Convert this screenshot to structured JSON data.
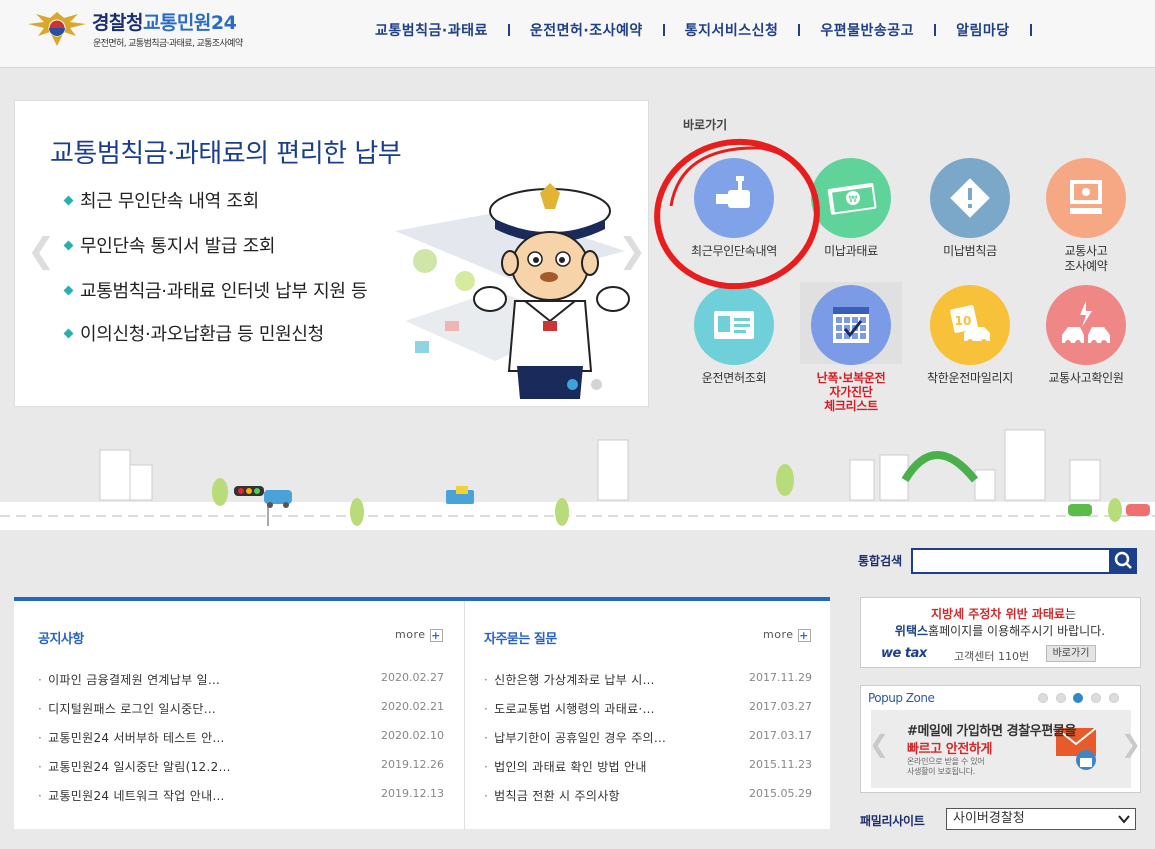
{
  "header": {
    "logo_title_1": "경찰청",
    "logo_title_2": "교통민원24",
    "logo_sub": "운전면허, 교통범칙금·과태료, 교통조사예약",
    "nav": [
      "교통범칙금·과태료",
      "운전면허·조사예약",
      "통지서비스신청",
      "우편물반송공고",
      "알림마당"
    ]
  },
  "banner": {
    "title": "교통범칙금·과태료의 편리한 납부",
    "bullets": [
      "최근 무인단속 내역 조회",
      "무인단속 통지서 발급 조회",
      "교통범칙금·과태료 인터넷 납부 지원 등",
      "이의신청·과오납환급 등 민원신청"
    ],
    "prev_arrow": "❮",
    "next_arrow": "❯",
    "active_slide": 1,
    "slide_count": 2
  },
  "quick": {
    "label": "바로가기",
    "items": [
      {
        "label": "최근무인단속내역",
        "color": "#7fa2e8",
        "icon": "camera-icon"
      },
      {
        "label": "미납과태료",
        "color": "#5fd39a",
        "icon": "money-icon"
      },
      {
        "label": "미납범칙금",
        "color": "#7ba7c9",
        "icon": "warning-icon"
      },
      {
        "label": "교통사고\n조사예약",
        "color": "#f5a883",
        "icon": "computer-icon"
      },
      {
        "label": "운전면허조회",
        "color": "#6fd0d9",
        "icon": "license-card-icon"
      },
      {
        "label": "난폭·보복운전\n자가진단\n체크리스트",
        "color": "#7b9be6",
        "icon": "calendar-check-icon"
      },
      {
        "label": "착한운전마일리지",
        "color": "#f7c23a",
        "icon": "mileage-car-icon"
      },
      {
        "label": "교통사고확인원",
        "color": "#ef8787",
        "icon": "car-crash-icon"
      }
    ]
  },
  "search": {
    "label": "통합검색",
    "placeholder": ""
  },
  "notice": {
    "title": "공지사항",
    "more": "more",
    "rows": [
      {
        "title": "이파인 금융결제원 연계납부 일…",
        "date": "2020.02.27"
      },
      {
        "title": "디지털원패스 로그인 일시중단…",
        "date": "2020.02.21"
      },
      {
        "title": "교통민원24 서버부하 테스트 안…",
        "date": "2020.02.10"
      },
      {
        "title": "교통민원24 일시중단 알림(12.2…",
        "date": "2019.12.26"
      },
      {
        "title": "교통민원24 네트워크 작업 안내…",
        "date": "2019.12.13"
      }
    ]
  },
  "faq": {
    "title": "자주묻는 질문",
    "more": "more",
    "rows": [
      {
        "title": "신한은행 가상계좌로 납부 시…",
        "date": "2017.11.29"
      },
      {
        "title": "도로교통법 시행령의 과태료·…",
        "date": "2017.03.27"
      },
      {
        "title": "납부기한이 공휴일인 경우 주의…",
        "date": "2017.03.17"
      },
      {
        "title": "법인의 과태료 확인 방법 안내",
        "date": "2015.11.23"
      },
      {
        "title": "범칙금 전환 시 주의사항",
        "date": "2015.05.29"
      }
    ]
  },
  "wetax": {
    "line1_red": "지방세 주정차 위반 과태료",
    "line1_rest": "는",
    "line2_bold": "위택스",
    "line2_rest": "홈페이지를 이용해주시기 바랍니다.",
    "logo": "we tax",
    "center": "고객센터 110번",
    "go": "바로가기"
  },
  "popup": {
    "title": "Popup Zone",
    "line1": "#메일에 가입하면 경찰우편물을",
    "line2": "빠르고 안전하게",
    "line3": "온라인으로 받을 수 있어",
    "line4": "사생활이 보호됩니다.",
    "dots": 5,
    "active_dot": 3
  },
  "family": {
    "label": "패밀리사이트",
    "selected": "사이버경찰청"
  }
}
